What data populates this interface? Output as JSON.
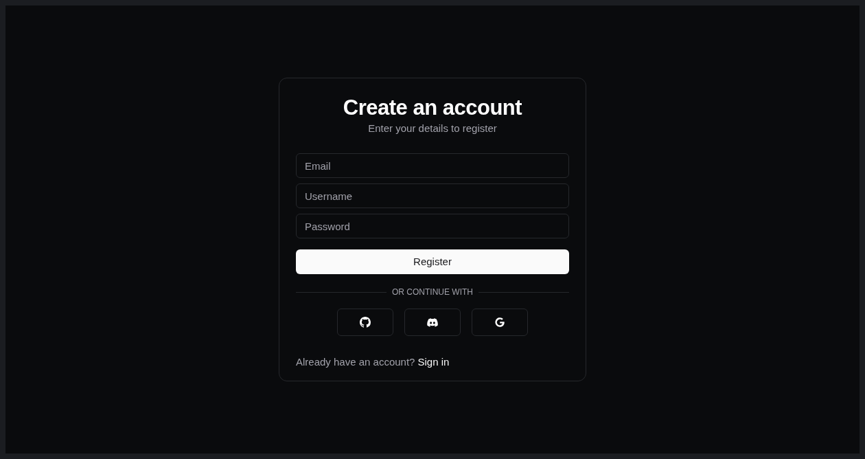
{
  "title": "Create an account",
  "subtitle": "Enter your details to register",
  "fields": [
    {
      "placeholder": "Email"
    },
    {
      "placeholder": "Username"
    },
    {
      "placeholder": "Password"
    }
  ],
  "submit": "Register",
  "divider": "OR CONTINUE WITH",
  "social_buttons": [
    {
      "kind": "github"
    },
    {
      "kind": "discord"
    },
    {
      "kind": "google"
    }
  ],
  "footer": {
    "text": "Already have an account?",
    "link": "Sign in"
  }
}
